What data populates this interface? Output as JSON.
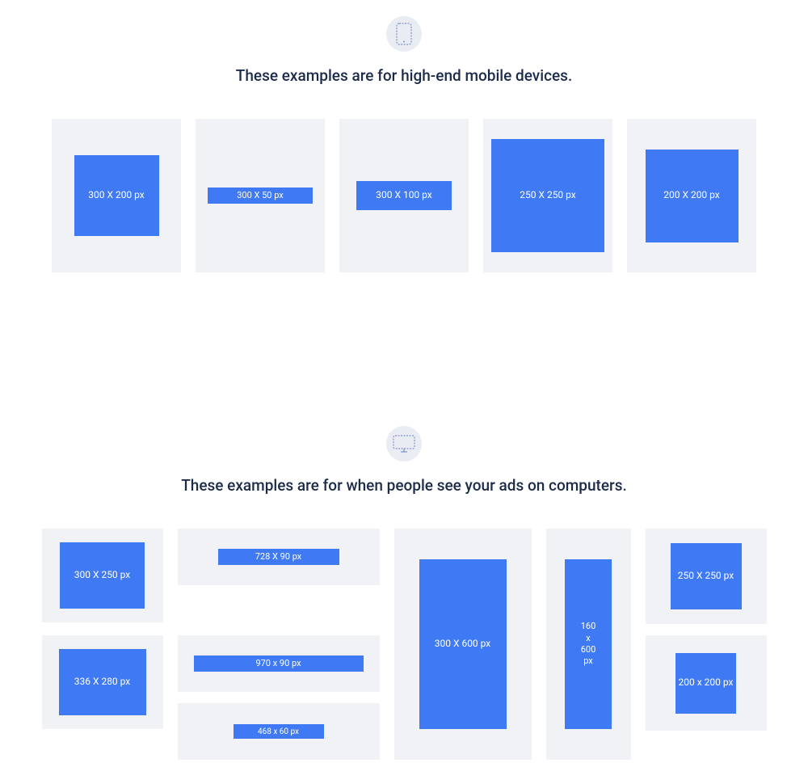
{
  "mobile": {
    "title": "These examples are for high-end mobile devices.",
    "icon": "mobile-device-icon",
    "cards": [
      {
        "label": "300 X 200 px"
      },
      {
        "label": "300 X 50 px"
      },
      {
        "label": "300 X 100 px"
      },
      {
        "label": "250 X 250 px"
      },
      {
        "label": "200 X 200 px"
      }
    ]
  },
  "desktop": {
    "title": "These examples are for when people see your ads on computers.",
    "icon": "desktop-monitor-icon",
    "cards": [
      {
        "label": "300 X 250 px"
      },
      {
        "label": "336 X 280 px"
      },
      {
        "label": "728 X 90 px"
      },
      {
        "label": "970 x 90 px"
      },
      {
        "label": "468 x 60 px"
      },
      {
        "label": "300 X 600 px"
      },
      {
        "label": "160\nx\n600\npx"
      },
      {
        "label": "250 X 250 px"
      },
      {
        "label": "200 x 200 px"
      }
    ]
  },
  "colors": {
    "adBackground": "#3f7af4",
    "cardBackground": "#f0f2f6",
    "iconCircle": "#e9ecf3",
    "text": "#1c2b4a"
  }
}
